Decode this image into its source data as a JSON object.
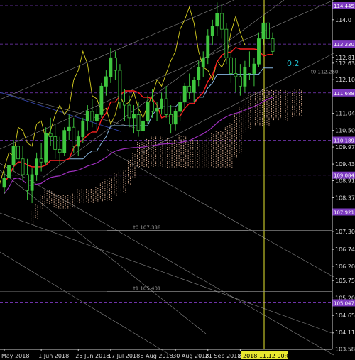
{
  "chart_data": {
    "type": "line",
    "instrument_style": "candlestick-with-ichimoku",
    "colors": {
      "background": "#000000",
      "bull_candle": "#3ec63e",
      "bear_candle": "#000000",
      "candle_outline": "#3ec63e",
      "tenkan": "#ff2020",
      "kijun": "#87b6e0",
      "chikou": "#d8d020",
      "cloud": "#f0c0a0",
      "ma_purple": "#a030c0",
      "grid": "#4d4d8a",
      "highlight_level": "#7d3ac0",
      "cursor_line": "#e8e830",
      "trend_lines": "#c0c0c0",
      "dark_blue_line": "#3040a0"
    },
    "ylim": [
      103.575,
      114.58
    ],
    "y_ticks": [
      {
        "label": "114.445",
        "value": 114.445,
        "highlight": true
      },
      {
        "label": "114.0",
        "value": 114.0,
        "highlight": false
      },
      {
        "label": "113.230",
        "value": 113.23,
        "highlight": true
      },
      {
        "label": "112.810",
        "value": 112.81,
        "highlight": false
      },
      {
        "label": "112.630",
        "value": 112.63,
        "highlight": false
      },
      {
        "label": "112.105",
        "value": 112.105,
        "highlight": false
      },
      {
        "label": "111.688",
        "value": 111.688,
        "highlight": true
      },
      {
        "label": "111.040",
        "value": 111.04,
        "highlight": false
      },
      {
        "label": "110.500",
        "value": 110.5,
        "highlight": false
      },
      {
        "label": "110.189",
        "value": 110.189,
        "highlight": true
      },
      {
        "label": "109.975",
        "value": 109.975,
        "highlight": false
      },
      {
        "label": "109.435",
        "value": 109.435,
        "highlight": false
      },
      {
        "label": "109.084",
        "value": 109.084,
        "highlight": true
      },
      {
        "label": "108.910",
        "value": 108.91,
        "highlight": false
      },
      {
        "label": "108.370",
        "value": 108.37,
        "highlight": false
      },
      {
        "label": "107.921",
        "value": 107.921,
        "highlight": true
      },
      {
        "label": "107.305",
        "value": 107.305,
        "highlight": false
      },
      {
        "label": "106.740",
        "value": 106.74,
        "highlight": false
      },
      {
        "label": "106.205",
        "value": 106.205,
        "highlight": false
      },
      {
        "label": "105.750",
        "value": 105.75,
        "highlight": false
      },
      {
        "label": "105.205",
        "value": 105.205,
        "highlight": false
      },
      {
        "label": "105.047",
        "value": 105.047,
        "highlight": true
      },
      {
        "label": "104.650",
        "value": 104.65,
        "highlight": false
      },
      {
        "label": "104.110",
        "value": 104.11,
        "highlight": false
      },
      {
        "label": "103.585",
        "value": 103.585,
        "highlight": false
      }
    ],
    "x_ticks": [
      {
        "label": "May 2018",
        "index": 0
      },
      {
        "label": "1 Jun 2018",
        "index": 8
      },
      {
        "label": "25 Jun 2018",
        "index": 16
      },
      {
        "label": "17 Jul 2018",
        "index": 23
      },
      {
        "label": "8 Aug 2018",
        "index": 30
      },
      {
        "label": "30 Aug 2018",
        "index": 37
      },
      {
        "label": "21 Sep 2018",
        "index": 44
      },
      {
        "label": "15 Oct 20",
        "index": 51
      }
    ],
    "cursor_date_label": "2018.11.12 00:00",
    "cursor_index": 58,
    "levels": [
      {
        "label": "t0 112.260",
        "value": 112.26
      },
      {
        "label": "t0 107.338",
        "value": 107.338
      },
      {
        "label": "t1 105.401",
        "value": 105.401
      }
    ],
    "annotation_text": "0.2",
    "candles": [
      [
        108.7,
        109.2,
        108.5,
        109.0
      ],
      [
        109.0,
        109.6,
        108.8,
        109.4
      ],
      [
        109.4,
        110.2,
        109.2,
        110.0
      ],
      [
        110.0,
        110.5,
        109.4,
        109.6
      ],
      [
        109.6,
        110.0,
        108.9,
        109.1
      ],
      [
        109.1,
        109.6,
        108.3,
        108.6
      ],
      [
        108.6,
        109.3,
        108.2,
        109.1
      ],
      [
        109.1,
        109.8,
        108.9,
        109.6
      ],
      [
        109.6,
        110.1,
        109.2,
        109.5
      ],
      [
        109.5,
        110.6,
        109.4,
        110.4
      ],
      [
        110.4,
        110.9,
        110.0,
        110.3
      ],
      [
        110.3,
        110.7,
        109.6,
        109.9
      ],
      [
        109.9,
        110.3,
        109.4,
        109.8
      ],
      [
        109.8,
        110.6,
        109.7,
        110.5
      ],
      [
        110.5,
        111.0,
        110.2,
        110.6
      ],
      [
        110.6,
        110.9,
        109.8,
        110.0
      ],
      [
        110.0,
        110.5,
        109.7,
        110.3
      ],
      [
        110.3,
        110.9,
        110.1,
        110.8
      ],
      [
        110.8,
        111.3,
        110.5,
        111.1
      ],
      [
        111.1,
        111.5,
        110.6,
        110.8
      ],
      [
        110.8,
        111.2,
        110.4,
        111.0
      ],
      [
        111.0,
        112.0,
        110.9,
        111.9
      ],
      [
        111.9,
        112.4,
        111.6,
        112.2
      ],
      [
        112.2,
        113.1,
        112.0,
        112.8
      ],
      [
        112.8,
        113.0,
        112.1,
        112.4
      ],
      [
        112.4,
        112.6,
        111.2,
        111.4
      ],
      [
        111.4,
        111.8,
        110.8,
        111.3
      ],
      [
        111.3,
        111.6,
        110.6,
        110.9
      ],
      [
        110.9,
        111.3,
        110.4,
        111.0
      ],
      [
        111.0,
        111.4,
        110.3,
        110.5
      ],
      [
        110.5,
        111.0,
        110.0,
        110.8
      ],
      [
        110.8,
        111.6,
        110.7,
        111.4
      ],
      [
        111.4,
        111.8,
        110.9,
        111.1
      ],
      [
        111.1,
        111.4,
        110.8,
        111.2
      ],
      [
        111.2,
        111.7,
        111.0,
        111.5
      ],
      [
        111.5,
        111.9,
        110.9,
        111.0
      ],
      [
        111.0,
        111.3,
        110.4,
        110.7
      ],
      [
        110.7,
        111.2,
        110.5,
        111.1
      ],
      [
        111.1,
        111.6,
        110.8,
        111.4
      ],
      [
        111.4,
        112.0,
        111.2,
        111.9
      ],
      [
        111.9,
        112.3,
        111.5,
        111.7
      ],
      [
        111.7,
        112.2,
        111.4,
        112.1
      ],
      [
        112.1,
        112.7,
        111.9,
        112.5
      ],
      [
        112.5,
        113.0,
        112.2,
        112.8
      ],
      [
        112.8,
        113.7,
        112.6,
        113.5
      ],
      [
        113.5,
        114.0,
        113.2,
        113.8
      ],
      [
        113.8,
        114.55,
        113.5,
        114.2
      ],
      [
        114.2,
        114.5,
        113.4,
        113.7
      ],
      [
        113.7,
        113.9,
        112.6,
        112.8
      ],
      [
        112.8,
        113.1,
        112.0,
        112.3
      ],
      [
        112.3,
        112.8,
        111.7,
        112.2
      ],
      [
        112.2,
        112.6,
        111.6,
        111.9
      ],
      [
        111.9,
        112.7,
        111.7,
        112.5
      ],
      [
        112.5,
        113.0,
        112.1,
        112.3
      ],
      [
        112.3,
        112.8,
        111.9,
        112.6
      ],
      [
        112.6,
        113.6,
        112.5,
        113.4
      ],
      [
        113.4,
        114.1,
        113.2,
        113.9
      ],
      [
        113.9,
        114.2,
        113.1,
        113.4
      ],
      [
        113.4,
        113.6,
        112.9,
        113.0
      ]
    ]
  }
}
